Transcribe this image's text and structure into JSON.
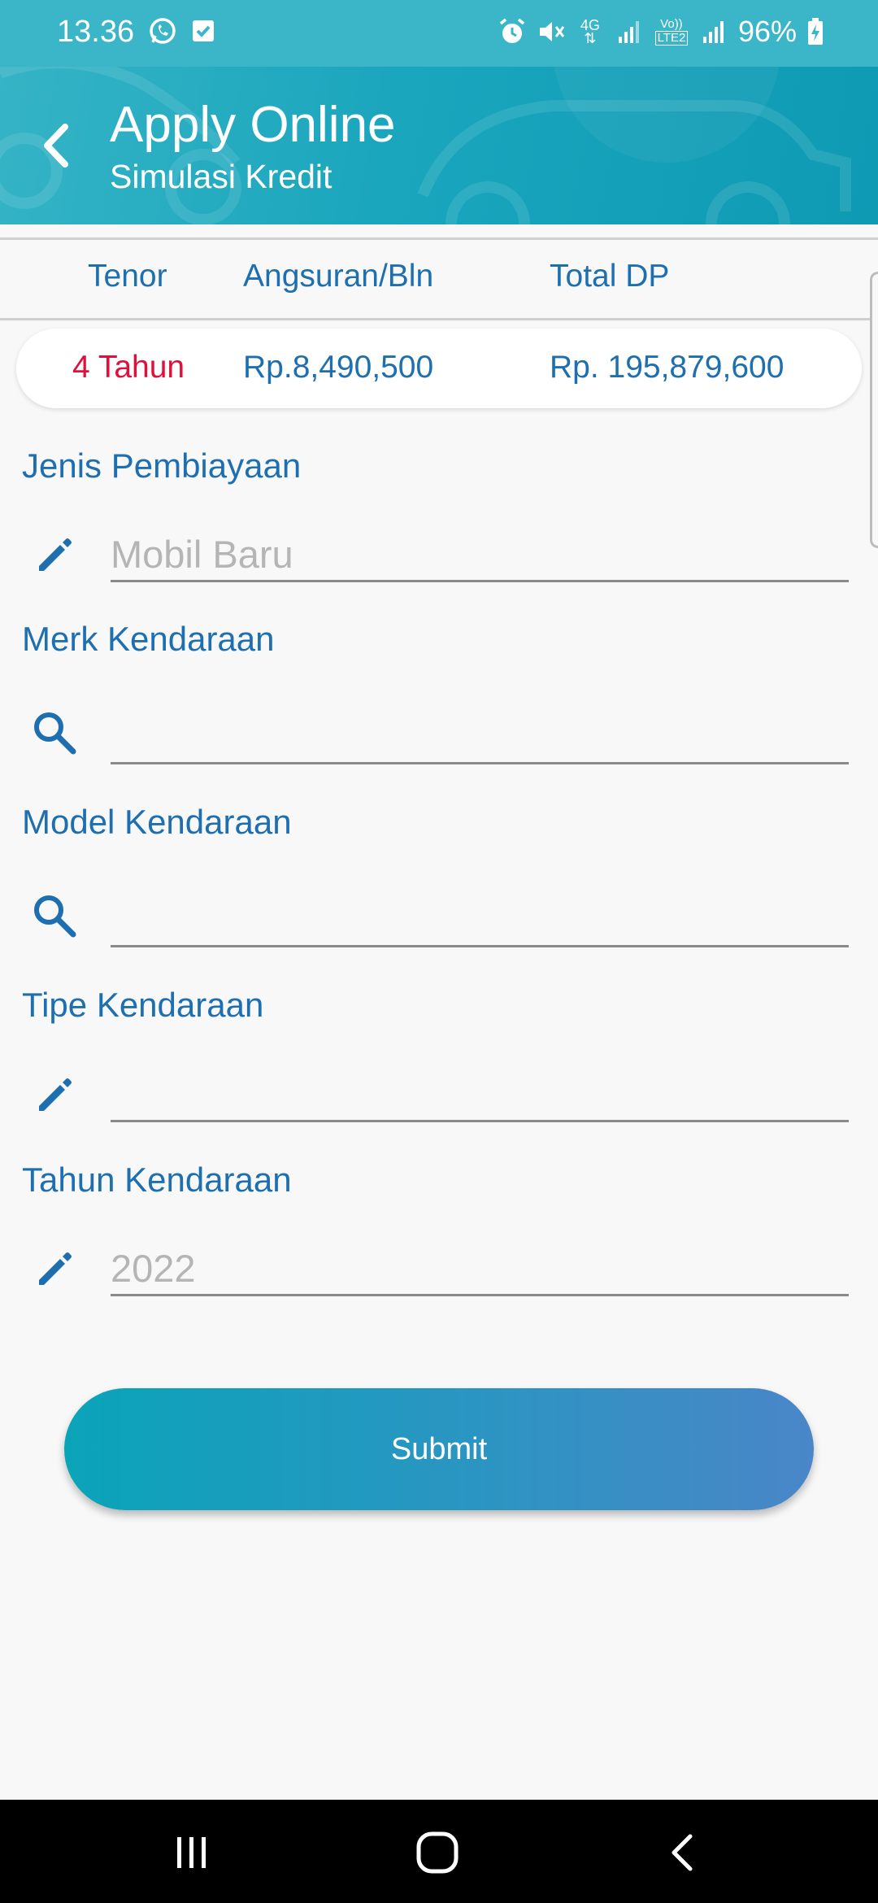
{
  "status_bar": {
    "time": "13.36",
    "battery": "96%",
    "network_4g": "4G",
    "volte": "Vo))",
    "lte": "LTE2"
  },
  "header": {
    "title": "Apply Online",
    "subtitle": "Simulasi Kredit"
  },
  "summary": {
    "columns": [
      "Tenor",
      "Angsuran/Bln",
      "Total DP"
    ],
    "values": [
      "4 Tahun",
      "Rp.8,490,500",
      "Rp. 195,879,600"
    ]
  },
  "form": {
    "fields": [
      {
        "label": "Jenis Pembiayaan",
        "value": "Mobil Baru",
        "icon": "pencil-icon"
      },
      {
        "label": "Merk Kendaraan",
        "value": "",
        "icon": "search-icon"
      },
      {
        "label": "Model Kendaraan",
        "value": "",
        "icon": "search-icon"
      },
      {
        "label": "Tipe Kendaraan",
        "value": "",
        "icon": "pencil-icon"
      },
      {
        "label": "Tahun Kendaraan",
        "value": "2022",
        "icon": "pencil-icon"
      }
    ],
    "submit_label": "Submit"
  },
  "colors": {
    "primary_blue": "#1d6fb0",
    "accent_red": "#e0103a",
    "header_teal": "#1aa6bd",
    "button_gradient_start": "#0aa4b9",
    "button_gradient_end": "#4a86c8"
  }
}
